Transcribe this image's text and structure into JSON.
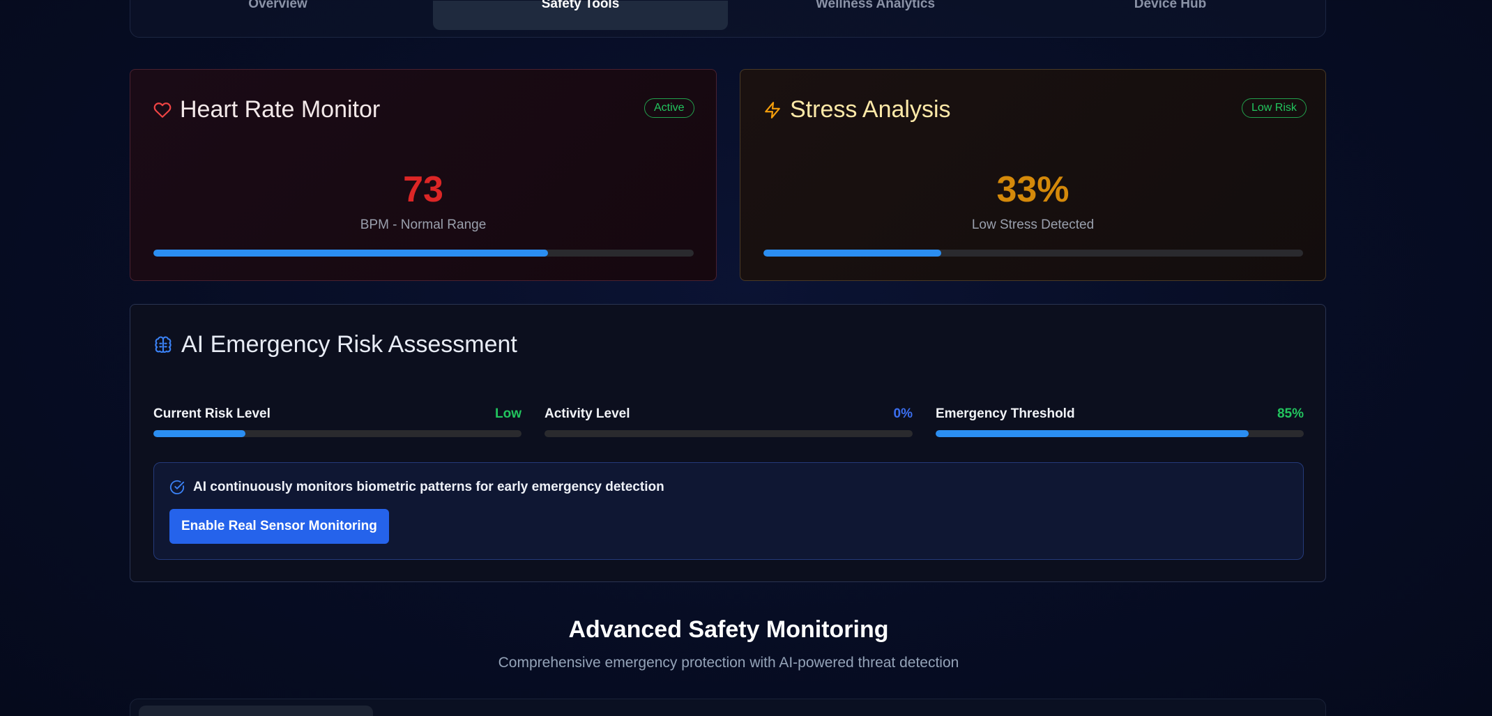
{
  "tabs": [
    {
      "label": "Overview",
      "active": false
    },
    {
      "label": "Safety Tools",
      "active": true
    },
    {
      "label": "Wellness Analytics",
      "active": false
    },
    {
      "label": "Device Hub",
      "active": false
    }
  ],
  "heart_rate": {
    "title": "Heart Rate Monitor",
    "icon": "heart-icon",
    "badge": "Active",
    "value": "73",
    "label": "BPM - Normal Range",
    "progress": 0.73,
    "value_color": "#dc2626"
  },
  "stress": {
    "title": "Stress Analysis",
    "icon": "lightning-icon",
    "badge": "Low Risk",
    "value": "33%",
    "label": "Low Stress Detected",
    "progress": 0.33,
    "value_color": "#d4890a"
  },
  "ai_assessment": {
    "title": "AI Emergency Risk Assessment",
    "icon": "brain-icon",
    "metrics": [
      {
        "label": "Current Risk Level",
        "value": "Low",
        "value_color": "#22c55e",
        "progress": 0.25
      },
      {
        "label": "Activity Level",
        "value": "0%",
        "value_color": "#3b6ef0",
        "progress": 0
      },
      {
        "label": "Emergency Threshold",
        "value": "85%",
        "value_color": "#22c55e",
        "progress": 0.85
      }
    ],
    "info_text": "AI continuously monitors biometric patterns for early emergency detection",
    "info_icon": "check-circle-icon",
    "button_label": "Enable Real Sensor Monitoring"
  },
  "section": {
    "title": "Advanced Safety Monitoring",
    "subtitle": "Comprehensive emergency protection with AI-powered threat detection"
  },
  "colors": {
    "accent": "#2563eb",
    "progress": "#2b8ef2",
    "success": "#22c55e"
  }
}
